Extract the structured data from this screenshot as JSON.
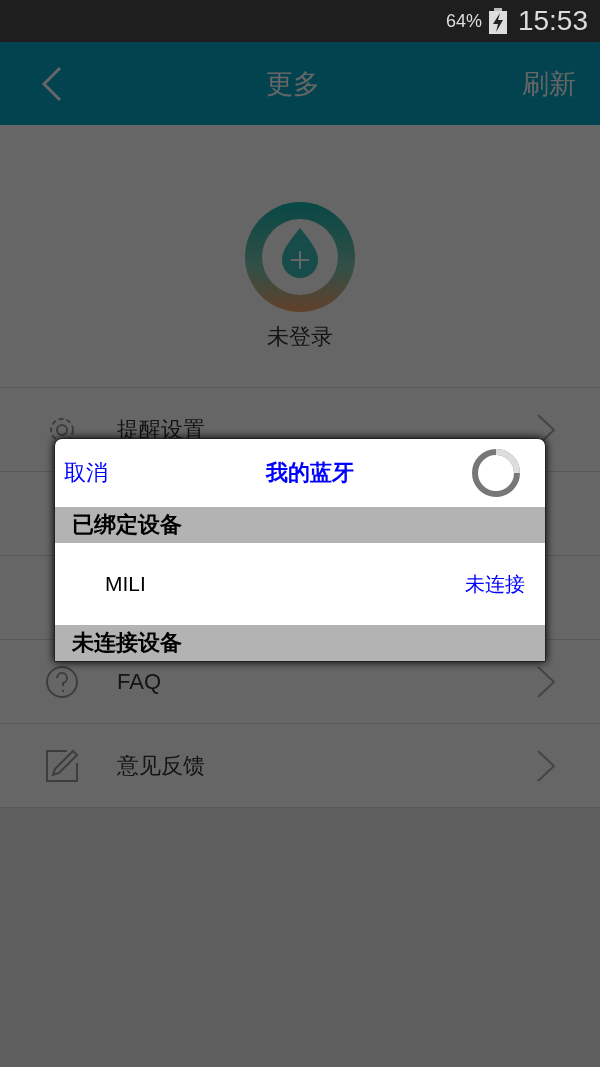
{
  "status_bar": {
    "battery": "64%",
    "time": "15:53"
  },
  "header": {
    "title": "更多",
    "action": "刷新"
  },
  "profile": {
    "name": "未登录"
  },
  "menu": [
    {
      "kind": "gear",
      "label": "提醒设置"
    },
    {
      "kind": "question",
      "label": "FAQ"
    },
    {
      "kind": "edit",
      "label": "意见反馈"
    }
  ],
  "dialog": {
    "cancel": "取消",
    "title": "我的蓝牙",
    "sections": [
      {
        "title": "已绑定设备",
        "devices": [
          {
            "name": "MILI",
            "status": "未连接"
          }
        ]
      },
      {
        "title": "未连接设备"
      }
    ]
  }
}
